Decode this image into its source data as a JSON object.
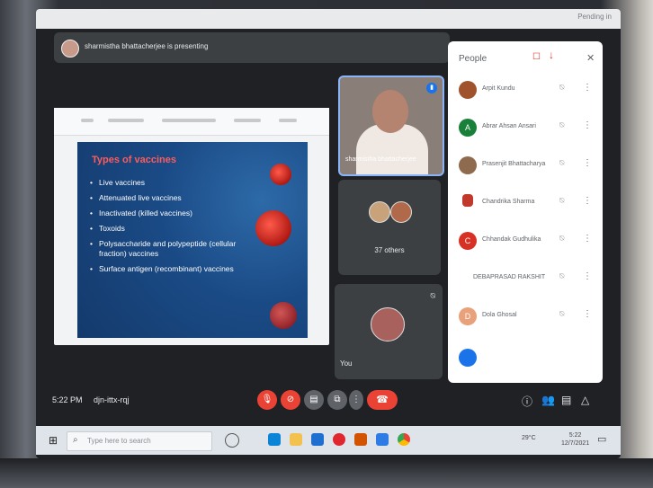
{
  "browser": {
    "tab_label": "Pending in"
  },
  "presenting_bar": {
    "text": "sharmistha bhattacherjee is presenting"
  },
  "slide": {
    "title": "Types of vaccines",
    "bullets": [
      "Live vaccines",
      "Attenuated live vaccines",
      "Inactivated (killed vaccines)",
      "Toxoids",
      "Polysaccharide and polypeptide (cellular fraction) vaccines",
      "Surface antigen (recombinant) vaccines"
    ]
  },
  "tiles": {
    "presenter_name": "sharmistha bhattacherjee",
    "others_label": "37 others",
    "you_label": "You"
  },
  "people_panel": {
    "title": "People",
    "participants": [
      {
        "name": "Arpit Kundu",
        "initial": "",
        "color": "#a0522d"
      },
      {
        "name": "Abrar Ahsan Ansari",
        "initial": "A",
        "color": "#188038"
      },
      {
        "name": "Prasenjit Bhattacharya",
        "initial": "",
        "color": "#8e6b4f"
      },
      {
        "name": "Chandrika Sharma",
        "initial": "",
        "color": "#c0392b"
      },
      {
        "name": "Chhandak Gudhulika",
        "initial": "C",
        "color": "#d93025"
      },
      {
        "name": "DEBAPRASAD RAKSHIT",
        "initial": "",
        "color": "#ffffff"
      },
      {
        "name": "Dola Ghosal",
        "initial": "D",
        "color": "#e8a17a"
      }
    ]
  },
  "meet_bar": {
    "time": "5:22 PM",
    "code": "djn-ittx-rqj"
  },
  "taskbar": {
    "search_placeholder": "Type here to search",
    "tray": "29°C",
    "clock_time": "5:22",
    "clock_date": "12/7/2021"
  },
  "colors": {
    "accent": "#8ab4f8",
    "end_call": "#ea4335",
    "mic_off": "#ea4335"
  }
}
